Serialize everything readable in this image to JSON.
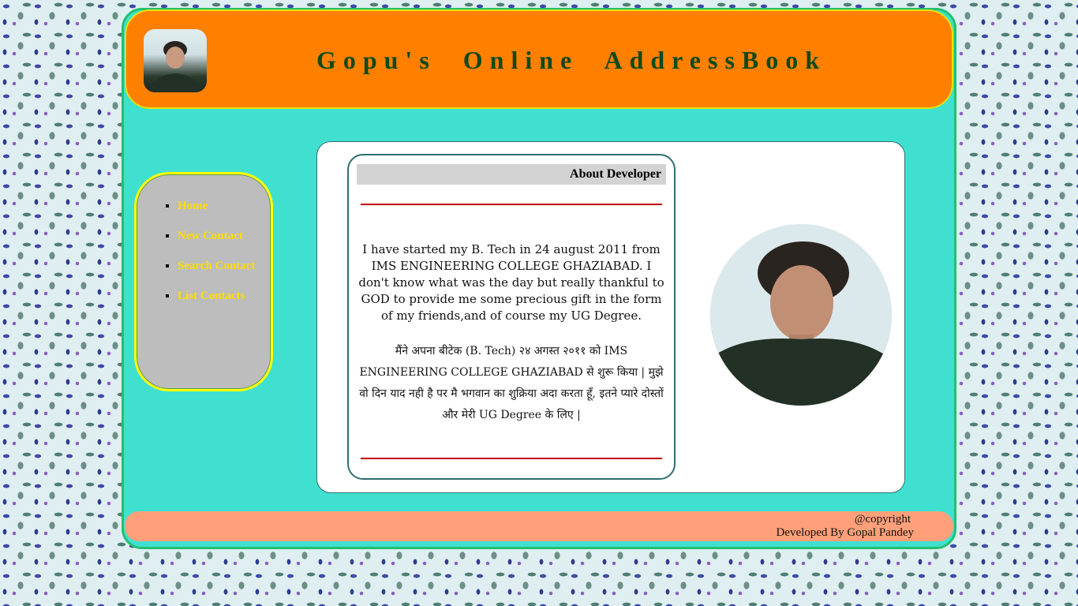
{
  "header": {
    "title": "Gopu's  Online  AddressBook",
    "avatar_icon": "profile-photo"
  },
  "nav": {
    "items": [
      {
        "label": "Home"
      },
      {
        "label": "New Contact"
      },
      {
        "label": "Search Contact"
      },
      {
        "label": "List Contacts"
      }
    ]
  },
  "about": {
    "heading": "About Developer",
    "paragraph_en": "I have started my B. Tech in 24 august 2011 from IMS ENGINEERING COLLEGE GHAZIABAD. I don't know what was the day but really thankful to GOD to provide me some precious gift in the form of my friends,and of course my UG Degree.",
    "paragraph_hi": "मैंने अपना बीटेक (B. Tech) २४ अगस्त २०११ को IMS ENGINEERING COLLEGE GHAZIABAD से शुरू किया | मुझे वो दिन याद नही है पर मै भगवान का शुक्रिया अदा करता हूँ, इतने प्यारे दोस्तों और मेरी UG Degree के लिए |",
    "photo_icon": "developer-photo"
  },
  "footer": {
    "copyright": "@copyright",
    "developer": "Developed By Gopal Pandey"
  },
  "colors": {
    "frame": "#40e0d0",
    "header": "#ff7f00",
    "title": "#0f4a1a",
    "nav_bg": "#bdbdbd",
    "nav_link": "#ffdd00",
    "footer": "#ffa07a",
    "rule": "#c00000"
  }
}
